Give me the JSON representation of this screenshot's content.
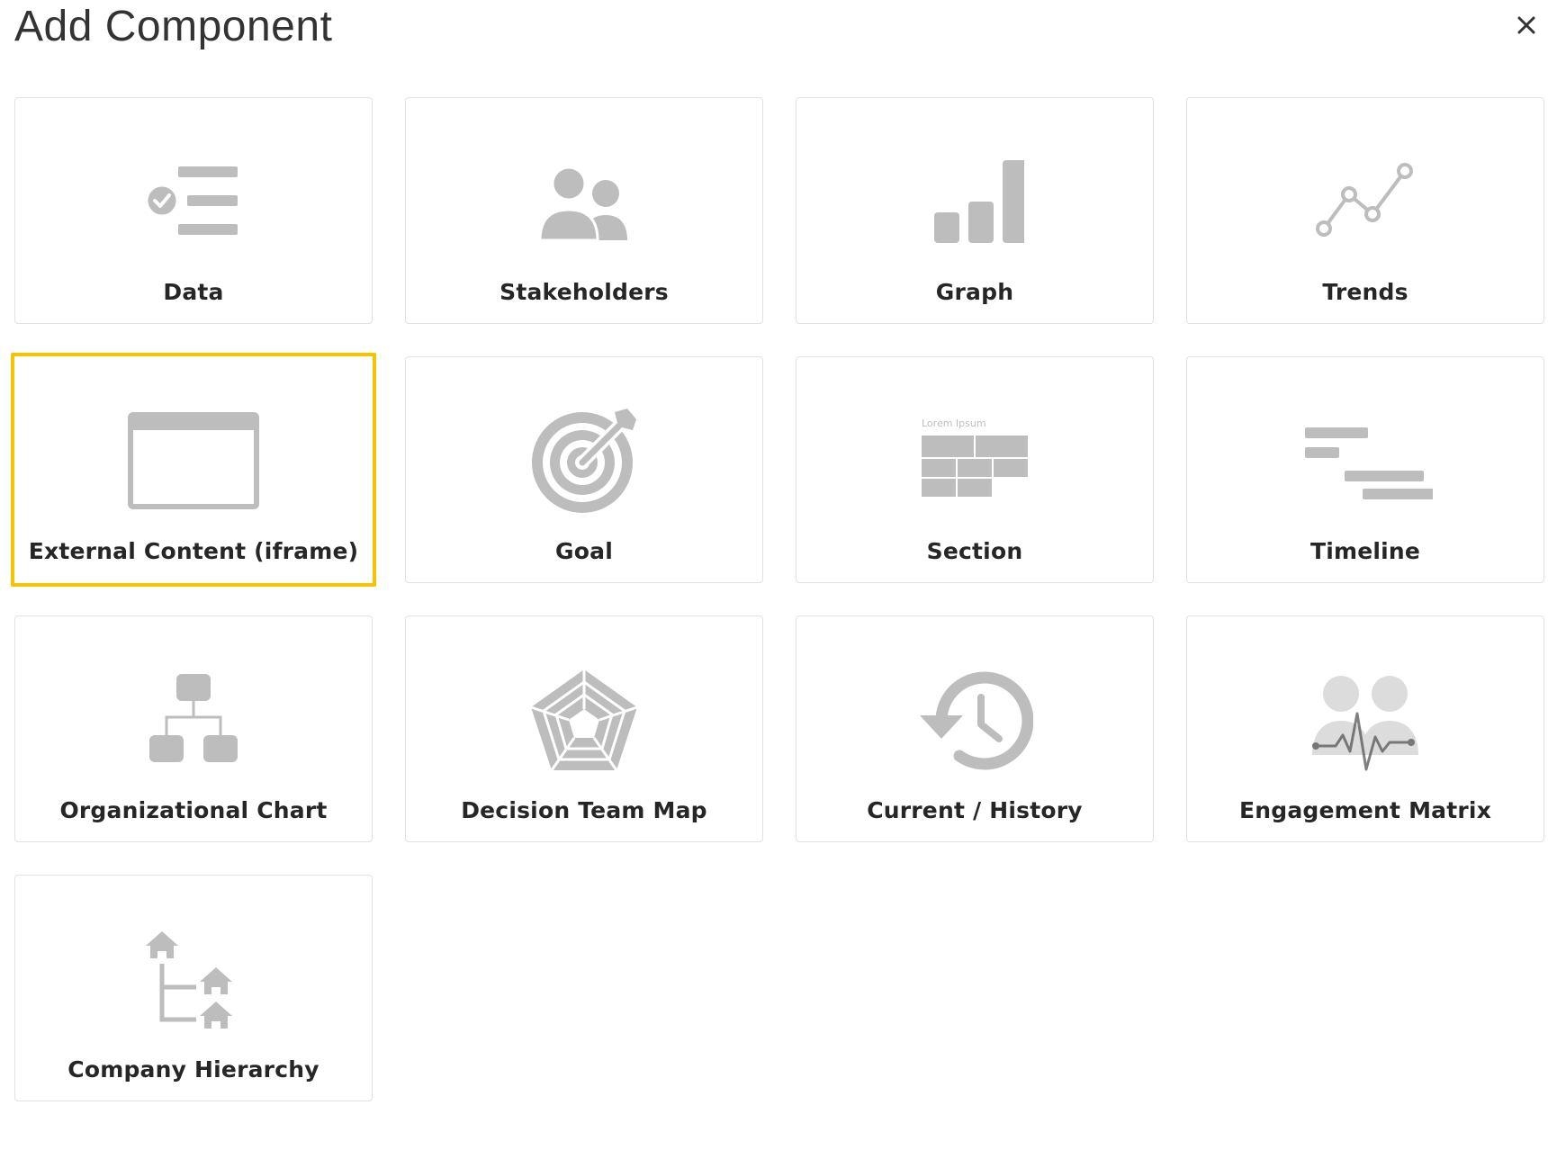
{
  "dialog": {
    "title": "Add Component",
    "close_label": "×"
  },
  "components": [
    {
      "label": "Data",
      "icon": "checklist-icon"
    },
    {
      "label": "Stakeholders",
      "icon": "people-icon"
    },
    {
      "label": "Graph",
      "icon": "bar-chart-icon"
    },
    {
      "label": "Trends",
      "icon": "line-chart-icon"
    },
    {
      "label": "External Content (iframe)",
      "icon": "browser-window-icon",
      "selected": true
    },
    {
      "label": "Goal",
      "icon": "target-icon"
    },
    {
      "label": "Section",
      "icon": "table-icon",
      "icon_text": "Lorem Ipsum"
    },
    {
      "label": "Timeline",
      "icon": "timeline-icon"
    },
    {
      "label": "Organizational Chart",
      "icon": "org-chart-icon"
    },
    {
      "label": "Decision Team Map",
      "icon": "radar-chart-icon"
    },
    {
      "label": "Current / History",
      "icon": "history-icon"
    },
    {
      "label": "Engagement Matrix",
      "icon": "engagement-icon"
    },
    {
      "label": "Company Hierarchy",
      "icon": "hierarchy-icon"
    }
  ],
  "colors": {
    "icon_gray": "#bdbdbd",
    "selected_border": "#f5c400",
    "card_border": "#e2e2e2"
  }
}
